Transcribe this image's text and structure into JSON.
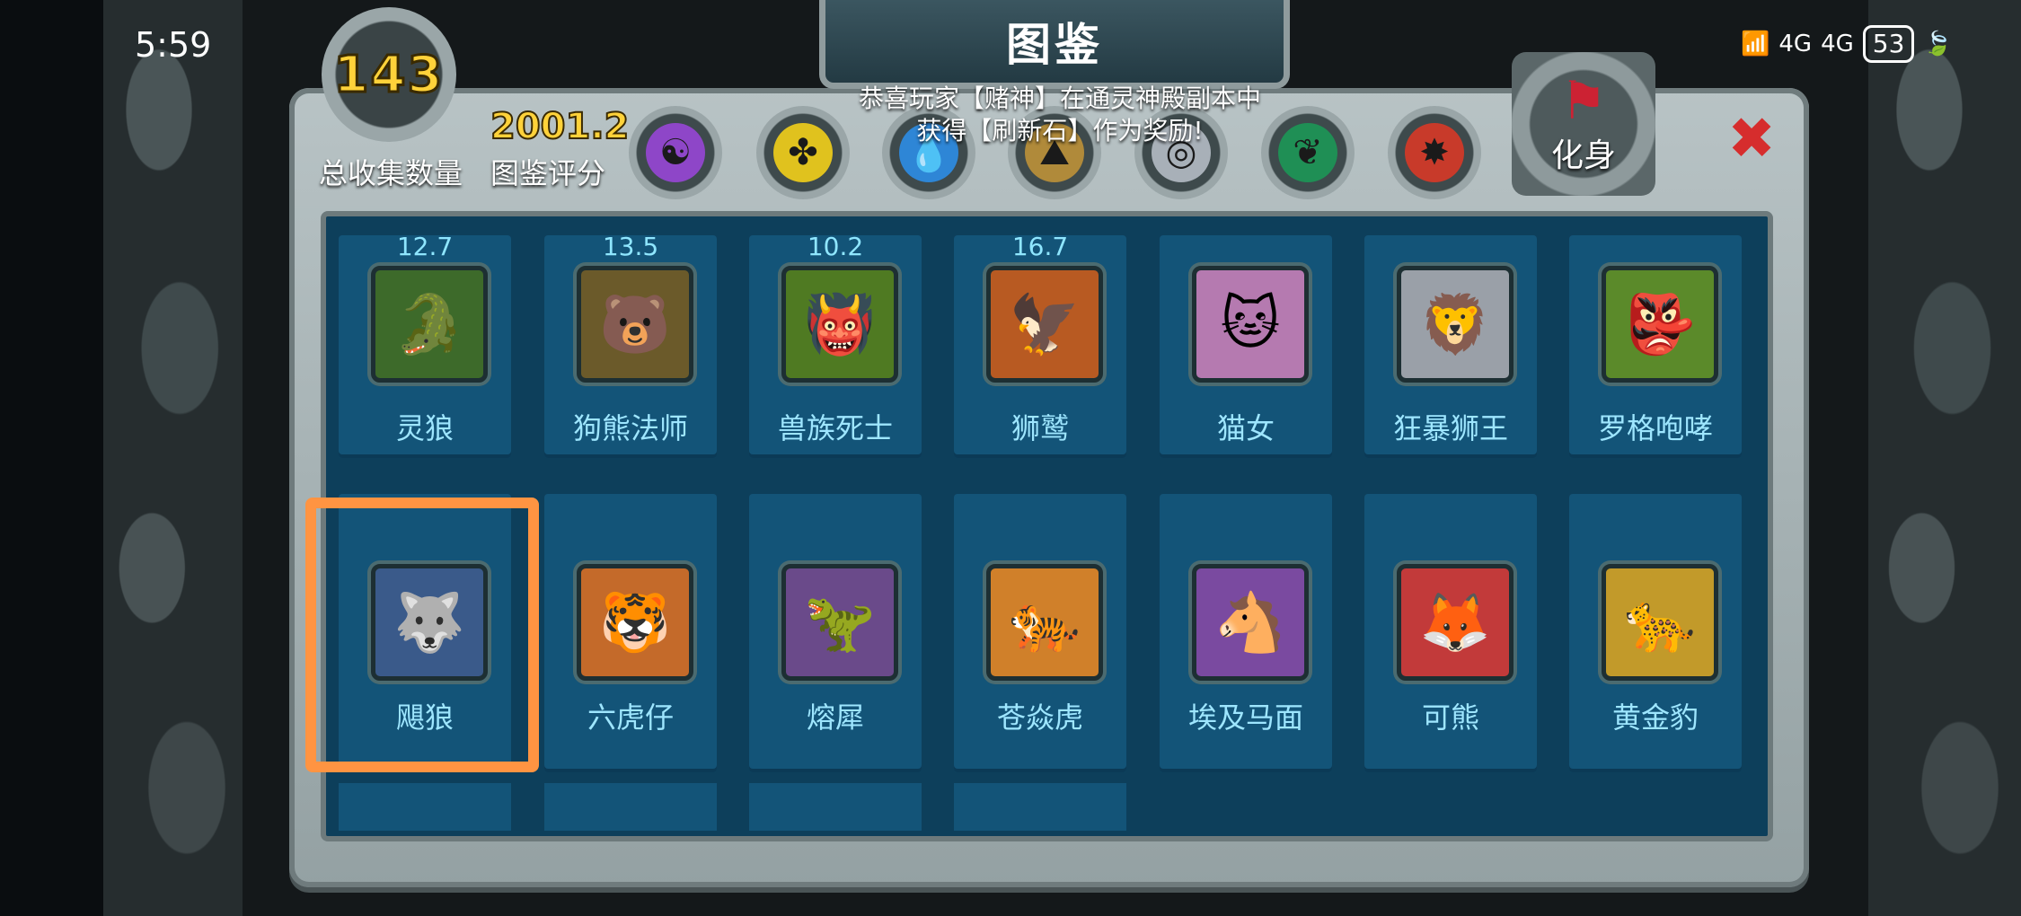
{
  "status": {
    "time": "5:59",
    "signal1": "4G",
    "signal2": "4G",
    "battery": "53"
  },
  "title": "图鉴",
  "notice": {
    "line1": "恭喜玩家【赌神】在通灵神殿副本中",
    "line2": "获得【刷新石】作为奖励!"
  },
  "collection": {
    "count": "143",
    "count_label": "总收集数量",
    "score": "2001.2",
    "score_label": "图鉴评分"
  },
  "filters": [
    {
      "icon": "shadow-element-icon",
      "glyph": "☯",
      "color": "#8e46c8"
    },
    {
      "icon": "beast-element-icon",
      "glyph": "✤",
      "color": "#e0c21e"
    },
    {
      "icon": "water-element-icon",
      "glyph": "💧",
      "color": "#2e86d6"
    },
    {
      "icon": "earth-element-icon",
      "glyph": "⛰",
      "color": "#b08a3a"
    },
    {
      "icon": "metal-element-icon",
      "glyph": "◎",
      "color": "#a8b0b8"
    },
    {
      "icon": "nature-element-icon",
      "glyph": "❦",
      "color": "#1f8f55"
    },
    {
      "icon": "dragon-element-icon",
      "glyph": "✸",
      "color": "#c83a2a"
    }
  ],
  "avatar_button": {
    "label": "化身"
  },
  "colors": {
    "accent_highlight": "#ff9442",
    "card_bg": "#135478",
    "panel_bg": "#0d3f5b"
  },
  "heroes": [
    {
      "name": "灵狼",
      "value": "12.7",
      "glyph": "🐊",
      "bg": "#3d6a2a"
    },
    {
      "name": "狗熊法师",
      "value": "13.5",
      "glyph": "🐻",
      "bg": "#6b5a2a"
    },
    {
      "name": "兽族死士",
      "value": "10.2",
      "glyph": "👹",
      "bg": "#4f7a22"
    },
    {
      "name": "狮鹫",
      "value": "16.7",
      "glyph": "🦅",
      "bg": "#b85a22"
    },
    {
      "name": "猫女",
      "value": "",
      "glyph": "🐱",
      "bg": "#b57ab0"
    },
    {
      "name": "狂暴狮王",
      "value": "",
      "glyph": "🦁",
      "bg": "#9aa0a8"
    },
    {
      "name": "罗格咆哮",
      "value": "",
      "glyph": "👺",
      "bg": "#5b8a2a"
    },
    {
      "name": "飓狼",
      "value": "",
      "glyph": "🐺",
      "bg": "#3a5a8a"
    },
    {
      "name": "六虎仔",
      "value": "",
      "glyph": "🐯",
      "bg": "#c46a2a"
    },
    {
      "name": "熔犀",
      "value": "",
      "glyph": "🦖",
      "bg": "#6a4a8a"
    },
    {
      "name": "苍焱虎",
      "value": "",
      "glyph": "🐅",
      "bg": "#d0802a"
    },
    {
      "name": "埃及马面",
      "value": "",
      "glyph": "🐴",
      "bg": "#7a4aa0"
    },
    {
      "name": "可熊",
      "value": "",
      "glyph": "🦊",
      "bg": "#c23a3a"
    },
    {
      "name": "黄金豹",
      "value": "",
      "glyph": "🐆",
      "bg": "#c29a2a"
    }
  ]
}
